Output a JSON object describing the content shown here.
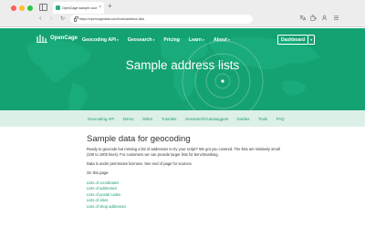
{
  "browser": {
    "tab_title": "OpenCage sample coordinates ...",
    "tab_close": "×",
    "new_tab": "+",
    "url": "https://opencagedata.com/tools/address-lists",
    "back": "‹",
    "forward": "›",
    "reload": "↻",
    "toolbar_icons": [
      "translate-icon",
      "extensions-icon",
      "profile-icon",
      "menu-icon"
    ]
  },
  "site": {
    "logo_name": "OpenCage",
    "brand_color": "#15a273",
    "nav": [
      {
        "label": "Geocoding API",
        "caret": "▾"
      },
      {
        "label": "Geosearch",
        "caret": "▾"
      },
      {
        "label": "Pricing",
        "caret": ""
      },
      {
        "label": "Learn",
        "caret": "▾"
      },
      {
        "label": "About",
        "caret": "▾"
      }
    ],
    "dashboard_label": "Dashboard",
    "dashboard_caret": "▾",
    "hero_title": "Sample address lists"
  },
  "subnav": [
    "Geocoding API",
    "Demo",
    "SDKs",
    "Tutorials",
    "Geosearch/Autosuggest",
    "Guides",
    "Tools",
    "FAQ"
  ],
  "content": {
    "heading": "Sample data for geocoding",
    "intro": "Ready to geocode but missing a list of addresses to try your script? We got you covered. The lists are relatively small (100 to 1000 lines). For customers we can provide larger lists for benchmarking.",
    "license": "Data is under permissive licenses. See end of page for sources.",
    "on_page": "On this page:",
    "links": [
      "Lists of coordinates",
      "Lists of addresses",
      "Lists of postal codes",
      "Lists of cities",
      "Lists of shop addresses"
    ]
  }
}
